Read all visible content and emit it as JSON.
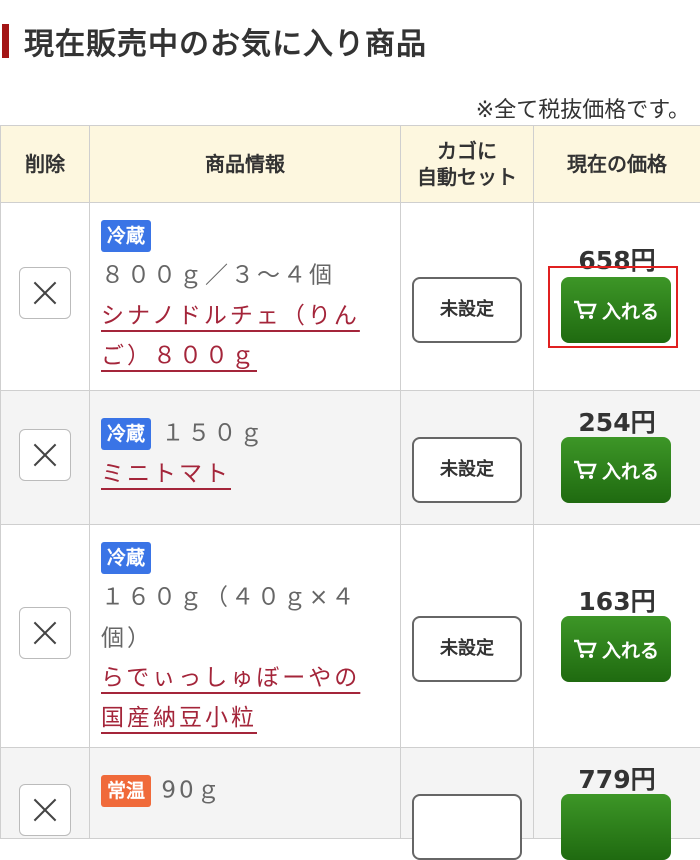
{
  "section_title": "現在販売中のお気に入り商品",
  "tax_note": "※全て税抜価格です。",
  "columns": {
    "delete": "削除",
    "info": "商品情報",
    "cart_set_line1": "カゴに",
    "cart_set_line2": "自動セット",
    "price": "現在の価格"
  },
  "items": [
    {
      "badge": "冷蔵",
      "spec": "８００ｇ／３〜４個",
      "name_line1": "シナノドルチェ（りん",
      "name_line2": "ご）８００ｇ",
      "set_label": "未設定",
      "price": "658円",
      "cart_label": "入れる"
    },
    {
      "badge": "冷蔵",
      "spec": "１５０ｇ",
      "name_line1": "ミニトマト",
      "set_label": "未設定",
      "price": "254円",
      "cart_label": "入れる"
    },
    {
      "badge": "冷蔵",
      "spec_line1": "１６０ｇ（４０ｇ×４",
      "spec_line2": "個）",
      "name_line1": "らでぃっしゅぼーやの",
      "name_line2": "国産納豆小粒",
      "set_label": "未設定",
      "price": "163円",
      "cart_label": "入れる"
    },
    {
      "badge": "常温",
      "spec": "90ｇ",
      "price": "779円"
    }
  ],
  "colors": {
    "accent": "#a31515",
    "badge_cold": "#3a74e6",
    "badge_room": "#f06a3a",
    "cart_button": "#2e7d1a",
    "link": "#a4253a",
    "highlight": "#e02020"
  },
  "icons": {
    "delete": "close-icon",
    "cart": "cart-icon"
  }
}
